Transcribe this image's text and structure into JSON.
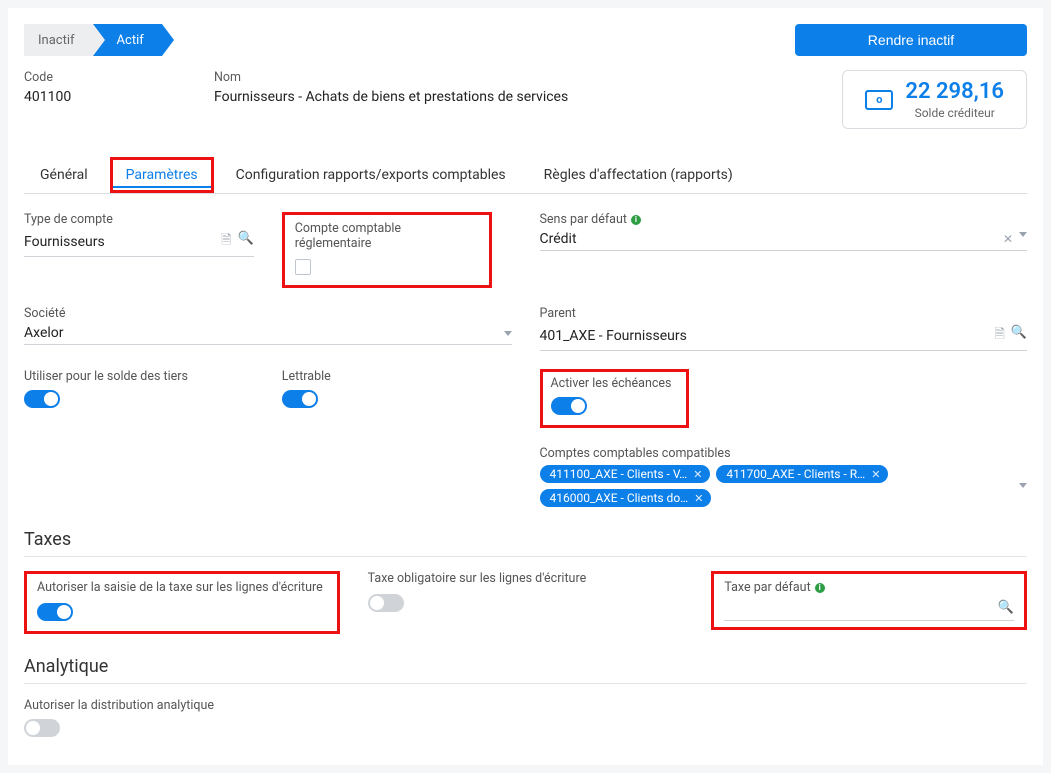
{
  "status": {
    "inactive": "Inactif",
    "active": "Actif",
    "deactivate_button": "Rendre inactif"
  },
  "header": {
    "code_label": "Code",
    "code_value": "401100",
    "name_label": "Nom",
    "name_value": "Fournisseurs - Achats de biens et prestations de services",
    "balance_amount": "22 298,16",
    "balance_label": "Solde créditeur"
  },
  "tabs": {
    "general": "Général",
    "parameters": "Paramètres",
    "config": "Configuration rapports/exports comptables",
    "rules": "Règles d'affectation (rapports)"
  },
  "form": {
    "account_type_label": "Type de compte",
    "account_type_value": "Fournisseurs",
    "regulatory_label": "Compte comptable réglementaire",
    "default_direction_label": "Sens par défaut",
    "default_direction_value": "Crédit",
    "company_label": "Société",
    "company_value": "Axelor",
    "parent_label": "Parent",
    "parent_value": "401_AXE - Fournisseurs",
    "third_party_balance_label": "Utiliser pour le solde des tiers",
    "letterable_label": "Lettrable",
    "enable_due_dates_label": "Activer les échéances",
    "compatible_accounts_label": "Comptes comptables compatibles",
    "chips": [
      "411100_AXE - Clients - V…",
      "411700_AXE - Clients - R…",
      "416000_AXE - Clients do…"
    ]
  },
  "taxes": {
    "section": "Taxes",
    "allow_tax_entry_label": "Autoriser la saisie de la taxe sur les lignes d'écriture",
    "tax_required_label": "Taxe obligatoire sur les lignes d'écriture",
    "default_tax_label": "Taxe par défaut"
  },
  "analytic": {
    "section": "Analytique",
    "allow_distribution_label": "Autoriser la distribution analytique"
  }
}
